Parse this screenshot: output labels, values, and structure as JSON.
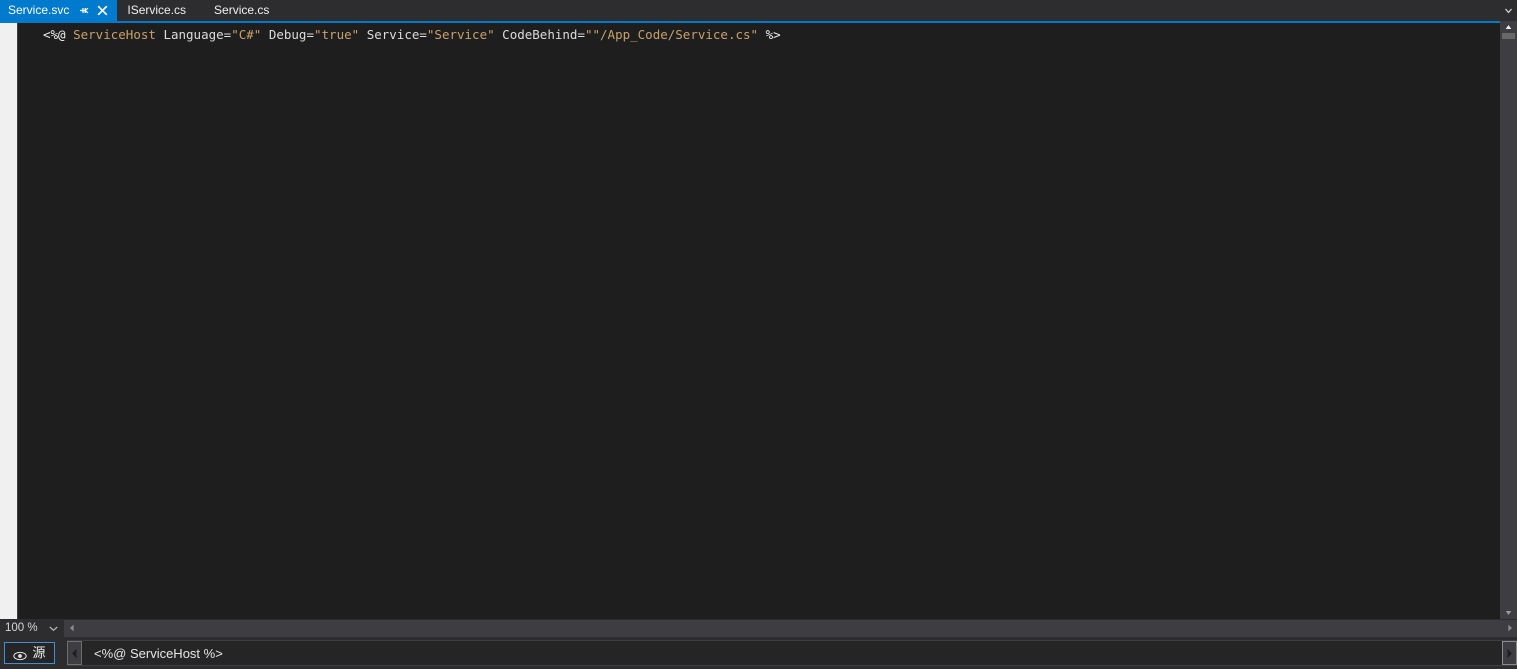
{
  "tabs": [
    {
      "label": "Service.svc",
      "active": true,
      "pinned": true,
      "closable": true
    },
    {
      "label": "IService.cs",
      "active": false,
      "pinned": false,
      "closable": false
    },
    {
      "label": "Service.cs",
      "active": false,
      "pinned": false,
      "closable": false
    }
  ],
  "tab_overflow_icon": "chevron-down-icon",
  "editor": {
    "line": {
      "open_delim": "<%@",
      "directive": "ServiceHost",
      "attributes": [
        {
          "name": "Language",
          "eq": "=",
          "value": "\"C#\""
        },
        {
          "name": "Debug",
          "eq": "=",
          "value": "\"true\""
        },
        {
          "name": "Service",
          "eq": "=",
          "value": "\"Service\""
        },
        {
          "name": "CodeBehind",
          "eq": "=",
          "value": "\"\"/App_Code/Service.cs\""
        }
      ],
      "close_delim": "%>",
      "full_text": "<%@ ServiceHost Language=\"C#\" Debug=\"true\" Service=\"Service\" CodeBehind=\"\"/App_Code/Service.cs\" %>"
    }
  },
  "zoombar": {
    "zoom_value": "100 %",
    "zoom_dropdown_icon": "chevron-down-icon",
    "scroll_left_icon": "arrow-left-icon",
    "scroll_right_icon": "arrow-right-icon"
  },
  "bottombar": {
    "view_button_label": "源",
    "view_button_icon": "eye-icon",
    "breadcrumb_text": "<%@ ServiceHost %>",
    "breadcrumb_prev_icon": "arrow-left-icon",
    "breadcrumb_next_icon": "arrow-right-icon"
  },
  "colors": {
    "accent": "#007acc",
    "editor_background": "#1e1e1e",
    "chrome_background": "#2d2d30",
    "gutter": "#f0f0f0",
    "token_name": "#c8a16a",
    "token_attr": "#dcdcdc",
    "token_delim": "#f0f0f0"
  }
}
